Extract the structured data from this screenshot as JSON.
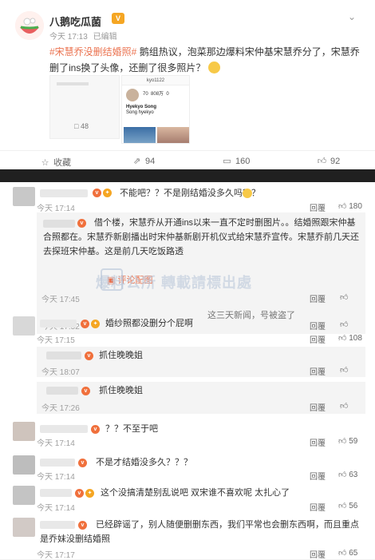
{
  "post": {
    "author": "八鹅吃瓜菌",
    "vip": "V",
    "time": "今天 17:13",
    "edited": "已编辑",
    "topic": "#宋慧乔没删结婚照#",
    "body": " 鹅组热议，泡菜那边爆料宋仲基宋慧乔分了，宋慧乔删了ins换了头像，还删了很多照片？",
    "thumb_count": "48",
    "ins_thumb": {
      "username": "kyo1122",
      "posts": "70",
      "followers": "808万",
      "following": "0",
      "name_line1": "Hyekyo Song",
      "name_line2": "Song hyekyo"
    },
    "actions": {
      "share": "收藏",
      "repost": "94",
      "comment": "160",
      "like": "92"
    }
  },
  "comments": [
    {
      "text": "不能吧？？不是刚结婚没多久吗？？",
      "time": "今天 17:14",
      "reply": "回覆",
      "likes": "180"
    },
    {
      "text": "借个楼，宋慧乔从开通ins以来一直不定时删图片。。结婚照跟宋仲基合照都在。宋慧乔新剧播出时宋仲基新剧开机仪式给宋慧乔宣传。宋慧乔前几天还去探班宋仲基。这是前几天吃饭路透",
      "link": "评论配图",
      "time": "今天 17:45",
      "reply": "回覆",
      "likes": ""
    },
    {
      "text": "这三天新闻，号被盗了",
      "time": "今天 17:52",
      "reply": "回覆",
      "likes": ""
    },
    {
      "text": "婚纱照都没删分个屁啊",
      "time": "今天 17:15",
      "reply": "回覆",
      "likes": "108"
    },
    {
      "text": "抓住晚晚姐",
      "time": "今天 18:07",
      "reply": "回覆",
      "likes": ""
    },
    {
      "text": "抓住晚晚姐",
      "time": "今天 17:26",
      "reply": "回覆",
      "likes": ""
    },
    {
      "text": "？？不至于吧",
      "time": "今天 17:14",
      "reply": "回覆",
      "likes": "59"
    },
    {
      "text": "不是才结婚没多久？？？",
      "time": "今天 17:14",
      "reply": "回覆",
      "likes": "63"
    },
    {
      "text": "这个没搞清楚别乱说吧 双宋谁不喜欢呢 太扎心了",
      "time": "今天 17:14",
      "reply": "回覆",
      "likes": "56"
    },
    {
      "text": "已经辟谣了，别人随便删删东西，我们平常也会删东西啊，而且重点是乔妹没删结婚照",
      "time": "今天 17:17",
      "reply": "回覆",
      "likes": "65"
    }
  ],
  "watermark": "爆料公所 轉載請標出處"
}
